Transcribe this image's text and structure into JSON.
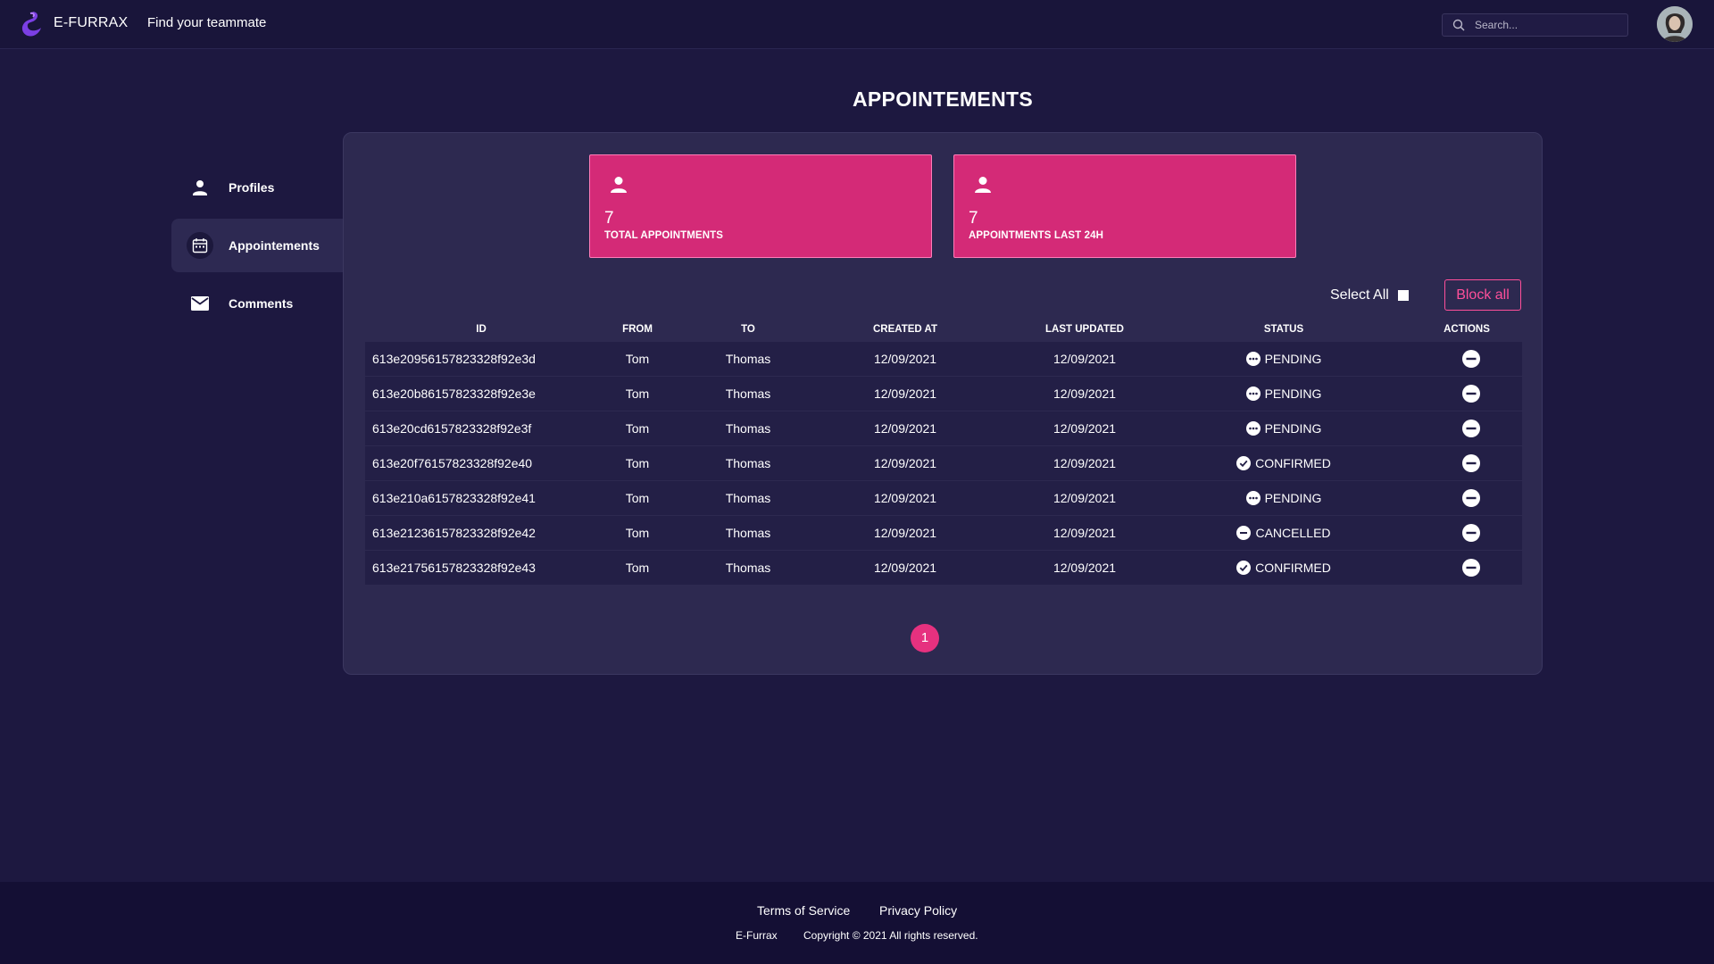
{
  "header": {
    "brand": "E-FURRAX",
    "tagline": "Find your teammate",
    "search_placeholder": "Search..."
  },
  "page_title": "APPOINTEMENTS",
  "sidebar": {
    "items": [
      {
        "label": "Profiles",
        "icon": "person-icon",
        "active": false
      },
      {
        "label": "Appointements",
        "icon": "calendar-icon",
        "active": true
      },
      {
        "label": "Comments",
        "icon": "mail-icon",
        "active": false
      }
    ]
  },
  "stats": [
    {
      "value": "7",
      "label": "TOTAL APPOINTMENTS"
    },
    {
      "value": "7",
      "label": "APPOINTMENTS LAST 24H"
    }
  ],
  "controls": {
    "select_all": "Select All",
    "block_all": "Block all"
  },
  "table": {
    "headers": [
      "ID",
      "FROM",
      "TO",
      "CREATED AT",
      "LAST UPDATED",
      "STATUS",
      "ACTIONS"
    ],
    "rows": [
      {
        "id": "613e20956157823328f92e3d",
        "from": "Tom",
        "to": "Thomas",
        "created": "12/09/2021",
        "updated": "12/09/2021",
        "status": "PENDING"
      },
      {
        "id": "613e20b86157823328f92e3e",
        "from": "Tom",
        "to": "Thomas",
        "created": "12/09/2021",
        "updated": "12/09/2021",
        "status": "PENDING"
      },
      {
        "id": "613e20cd6157823328f92e3f",
        "from": "Tom",
        "to": "Thomas",
        "created": "12/09/2021",
        "updated": "12/09/2021",
        "status": "PENDING"
      },
      {
        "id": "613e20f76157823328f92e40",
        "from": "Tom",
        "to": "Thomas",
        "created": "12/09/2021",
        "updated": "12/09/2021",
        "status": "CONFIRMED"
      },
      {
        "id": "613e210a6157823328f92e41",
        "from": "Tom",
        "to": "Thomas",
        "created": "12/09/2021",
        "updated": "12/09/2021",
        "status": "PENDING"
      },
      {
        "id": "613e21236157823328f92e42",
        "from": "Tom",
        "to": "Thomas",
        "created": "12/09/2021",
        "updated": "12/09/2021",
        "status": "CANCELLED"
      },
      {
        "id": "613e21756157823328f92e43",
        "from": "Tom",
        "to": "Thomas",
        "created": "12/09/2021",
        "updated": "12/09/2021",
        "status": "CONFIRMED"
      }
    ]
  },
  "pagination": {
    "current": "1"
  },
  "footer": {
    "terms": "Terms of Service",
    "privacy": "Privacy Policy",
    "company": "E-Furrax",
    "copyright": "Copyright © 2021 All rights reserved."
  },
  "colors": {
    "background": "#1d1840",
    "panel": "#2d2950",
    "accent": "#d42a77",
    "accent_light": "#ff4f9a"
  }
}
